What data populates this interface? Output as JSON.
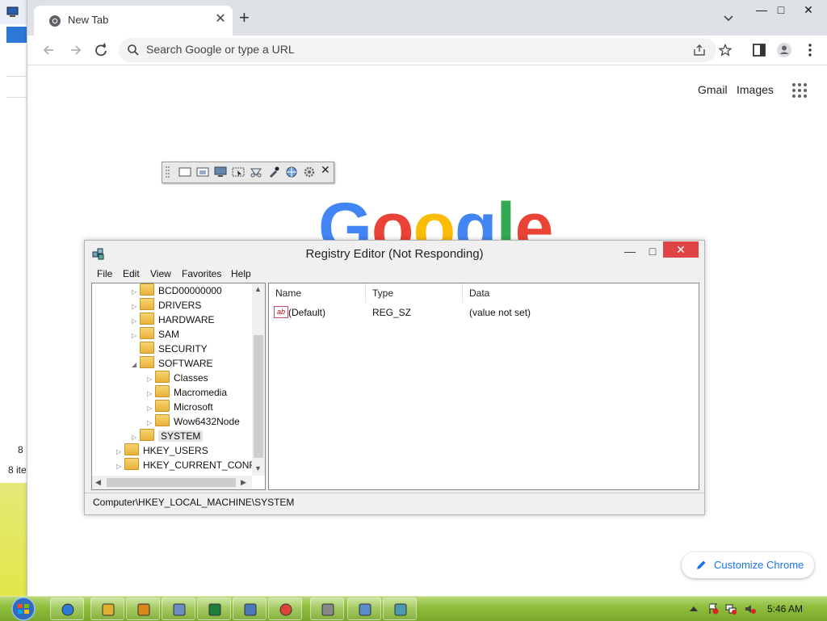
{
  "background_window": {
    "lines": [
      "8",
      "8 ite"
    ]
  },
  "chrome": {
    "tab_title": "New Tab",
    "new_tab_label": "+",
    "window_controls": {
      "minimize": "—",
      "maximize": "□",
      "close": "✕"
    },
    "omnibox_placeholder": "Search Google or type a URL",
    "links": {
      "gmail": "Gmail",
      "images": "Images"
    },
    "logo": [
      "G",
      "o",
      "o",
      "g",
      "l",
      "e"
    ],
    "logo_colors": [
      "#4285f4",
      "#ea4335",
      "#fbbc05",
      "#4285f4",
      "#34a853",
      "#ea4335"
    ],
    "customize_label": "Customize Chrome",
    "accent": "#1a73e8"
  },
  "regedit": {
    "title": "Registry Editor (Not Responding)",
    "menu": [
      "File",
      "Edit",
      "View",
      "Favorites",
      "Help"
    ],
    "tree": [
      {
        "label": "BCD00000000",
        "level": 2,
        "expander": "▷"
      },
      {
        "label": "DRIVERS",
        "level": 2,
        "expander": "▷"
      },
      {
        "label": "HARDWARE",
        "level": 2,
        "expander": "▷"
      },
      {
        "label": "SAM",
        "level": 2,
        "expander": "▷"
      },
      {
        "label": "SECURITY",
        "level": 2,
        "expander": ""
      },
      {
        "label": "SOFTWARE",
        "level": 2,
        "expander": "◢"
      },
      {
        "label": "Classes",
        "level": 3,
        "expander": "▷"
      },
      {
        "label": "Macromedia",
        "level": 3,
        "expander": "▷"
      },
      {
        "label": "Microsoft",
        "level": 3,
        "expander": "▷"
      },
      {
        "label": "Wow6432Node",
        "level": 3,
        "expander": "▷"
      },
      {
        "label": "SYSTEM",
        "level": 2,
        "expander": "▷",
        "selected": true
      },
      {
        "label": "HKEY_USERS",
        "level": 1,
        "expander": "▷"
      },
      {
        "label": "HKEY_CURRENT_CONFIG",
        "level": 1,
        "expander": "▷"
      }
    ],
    "columns": [
      "Name",
      "Type",
      "Data"
    ],
    "rows": [
      {
        "name": "(Default)",
        "type": "REG_SZ",
        "data": "(value not set)"
      }
    ],
    "status_path": "Computer\\HKEY_LOCAL_MACHINE\\SYSTEM",
    "close_color": "#e04343"
  },
  "taskbar": {
    "clock": "5:46 AM",
    "buttons": [
      "ie-icon",
      "explorer-icon",
      "media-player-icon",
      "document-icon",
      "excel-icon",
      "network-icon",
      "chrome-icon",
      "printer-icon",
      "window-icon",
      "regedit-icon"
    ]
  }
}
